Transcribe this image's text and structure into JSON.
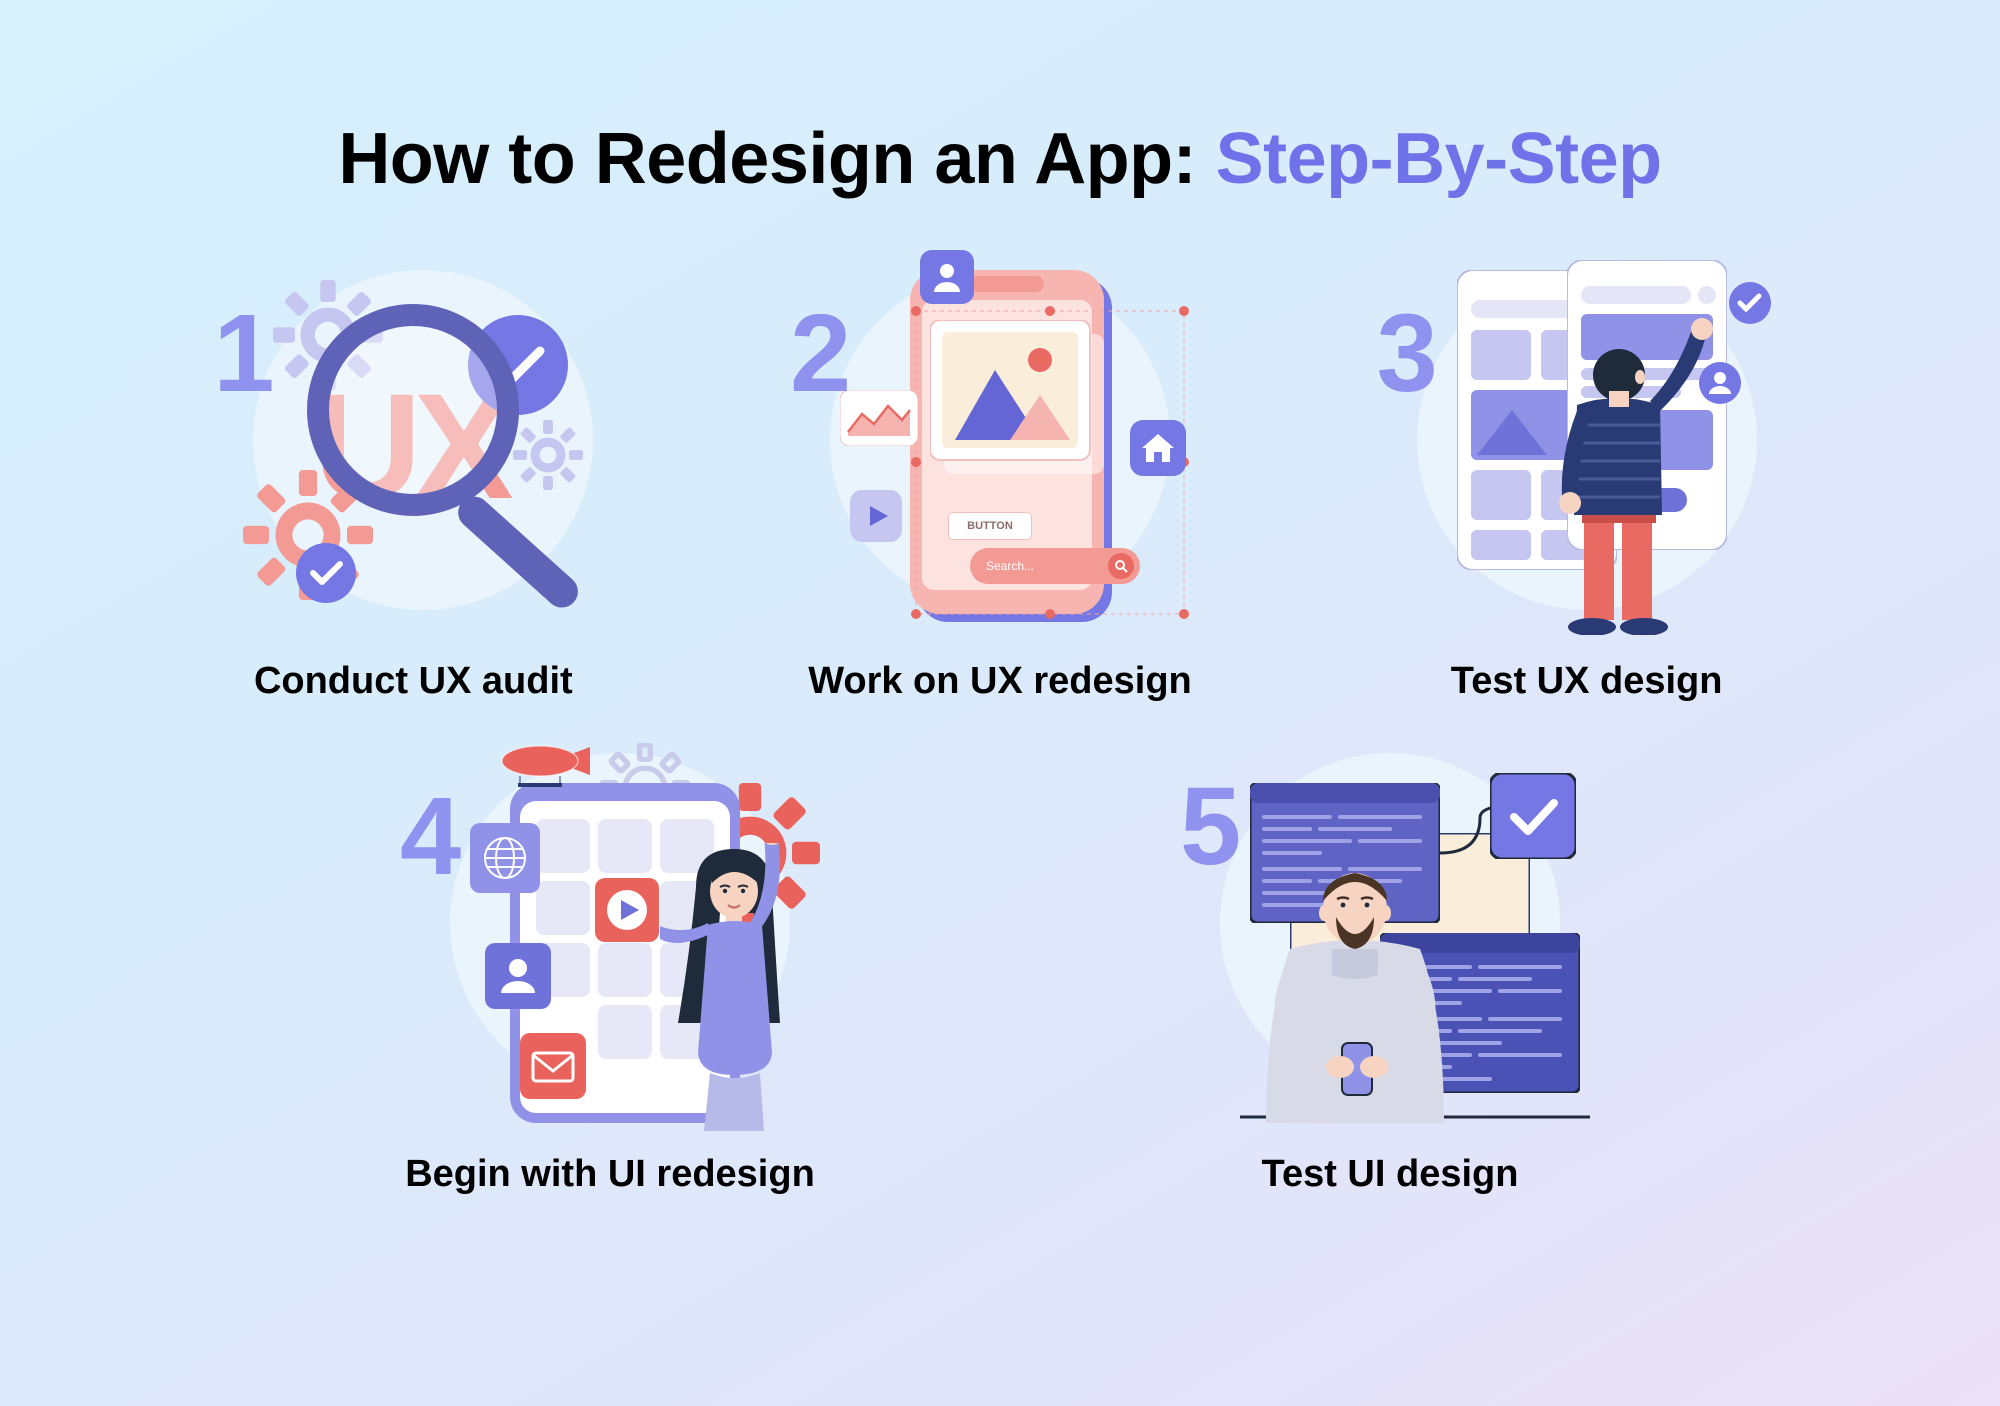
{
  "title": {
    "main": "How to Redesign an App: ",
    "accent": "Step-By-Step"
  },
  "steps": [
    {
      "num": "1",
      "caption": "Conduct UX audit"
    },
    {
      "num": "2",
      "caption": "Work on UX redesign"
    },
    {
      "num": "3",
      "caption": "Test UX design"
    },
    {
      "num": "4",
      "caption": "Begin with UI redesign"
    },
    {
      "num": "5",
      "caption": "Test UI design"
    }
  ],
  "illus": {
    "ux_text": "UX",
    "button_label": "BUTTON",
    "search_label": "Search..."
  },
  "colors": {
    "accent": "#6f72e9",
    "salmon": "#f39a95",
    "salmon_dark": "#e96a63",
    "violet": "#7577e4",
    "lavender": "#c5c7f1",
    "cream": "#faeedb",
    "navy": "#2a3a75",
    "skin": "#f7d4c2",
    "hair": "#1f2a3a",
    "shirt_blue": "#8f92e6"
  }
}
